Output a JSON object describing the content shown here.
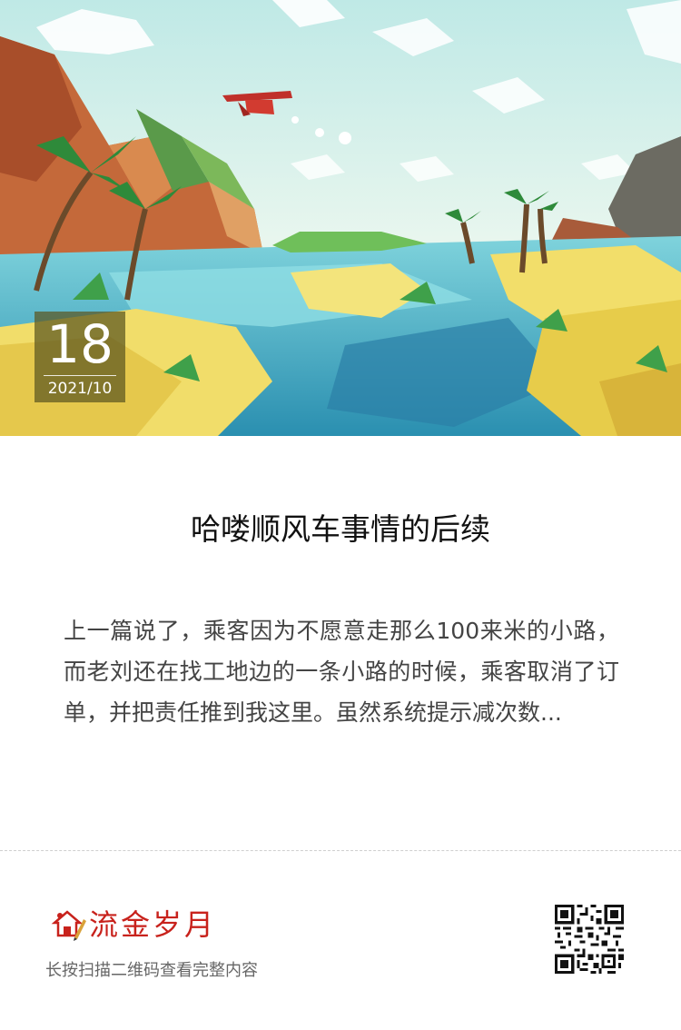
{
  "hero": {
    "date": {
      "day": "18",
      "year_month": "2021/10"
    }
  },
  "article": {
    "title": "哈喽顺风车事情的后续",
    "excerpt": "上一篇说了，乘客因为不愿意走那么100来米的小路，而老刘还在找工地边的一条小路的时候，乘客取消了订单，并把责任推到我这里。虽然系统提示减次数..."
  },
  "footer": {
    "brand_name": "流金岁月",
    "scan_hint": "长按扫描二维码查看完整内容"
  },
  "colors": {
    "brand": "#c8221c",
    "badge_bg": "#5c5620",
    "title": "#111111",
    "excerpt": "#444444",
    "hint": "#666666"
  },
  "icons": {
    "brand_logo": "house-pencil-icon",
    "qr": "qr-code"
  }
}
